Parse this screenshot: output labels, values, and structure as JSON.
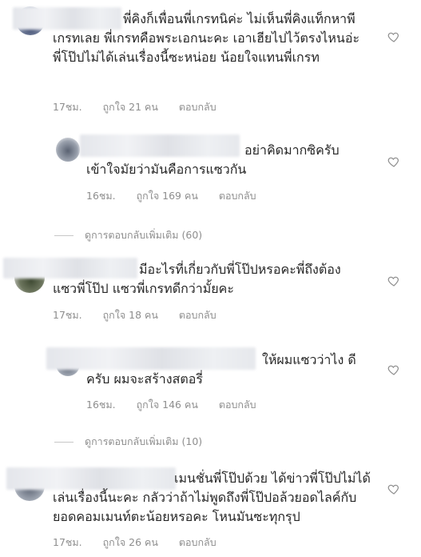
{
  "comments": [
    {
      "text": "พี่คิงก็เพื่อนพี่เกรทนิค่ะ ไม่เห็นพี่คิงแท็กหาพีเกรทเลย พี่เกรทคือพระเอกนะคะ เอาเฮียไปไว้ตรงไหนอ่ะ พี่โป๊ปไม่ได้เล่นเรื่องนี้ซะหน่อย น้อยใจแทนพี่เกรท",
      "time": "17ชม.",
      "likes": "ถูกใจ 21 คน",
      "reply": "ตอบกลับ"
    },
    {
      "text": "อย่าคิดมากซิครับ เข้าใจมัยว่ามันคือการแซวกัน",
      "time": "16ชม.",
      "likes": "ถูกใจ 169 คน",
      "reply": "ตอบกลับ"
    },
    {
      "text": "มีอะไรที่เกี่ยวกับพี่โป๊ปหรอคะพี่ถึงต้องแซวพี่โป๊ป แซวพี่เกรทดีกว่ามั้ยคะ",
      "time": "17ชม.",
      "likes": "ถูกใจ 18 คน",
      "reply": "ตอบกลับ"
    },
    {
      "text": "ให้ผมแซวว่าไง ดีครับ ผมจะสร้างสตอรี่",
      "time": "16ชม.",
      "likes": "ถูกใจ 146 คน",
      "reply": "ตอบกลับ"
    },
    {
      "text": "เมนชั่นพี่โป๊ปด้วย ได้ข่าวพี่โป๊ปไม่ได้เล่นเรื่องนี้นะคะ กลัวว่าถ้าไม่พูดถึงพี่โป๊ปอล้วยอดไลค์กับยอดคอมเมนท์ตะน้อยหรอคะ โหนมันซะทุกรุป",
      "time": "17ชม.",
      "likes": "ถูกใจ 26 คน",
      "reply": "ตอบกลับ"
    }
  ],
  "view_more": [
    {
      "label": "ดูการตอบกลับเพิ่มเติม (60)"
    },
    {
      "label": "ดูการตอบกลับเพิ่มเติม (10)"
    }
  ],
  "icons": {
    "like": "heart-outline-icon"
  },
  "colors": {
    "text": "#262626",
    "meta": "#8e8e8e",
    "icon": "#8e8e8e"
  }
}
